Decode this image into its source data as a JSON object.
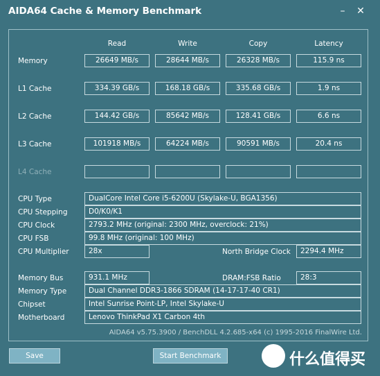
{
  "window": {
    "title": "AIDA64 Cache & Memory Benchmark",
    "minimize": "–",
    "close": "✕"
  },
  "columns": [
    "Read",
    "Write",
    "Copy",
    "Latency"
  ],
  "rows": [
    {
      "label": "Memory",
      "read": "26649 MB/s",
      "write": "28644 MB/s",
      "copy": "26328 MB/s",
      "latency": "115.9 ns"
    },
    {
      "label": "L1 Cache",
      "read": "334.39 GB/s",
      "write": "168.18 GB/s",
      "copy": "335.68 GB/s",
      "latency": "1.9 ns"
    },
    {
      "label": "L2 Cache",
      "read": "144.42 GB/s",
      "write": "85642 MB/s",
      "copy": "128.41 GB/s",
      "latency": "6.6 ns"
    },
    {
      "label": "L3 Cache",
      "read": "101918 MB/s",
      "write": "64224 MB/s",
      "copy": "90591 MB/s",
      "latency": "20.4 ns"
    },
    {
      "label": "L4 Cache",
      "read": "",
      "write": "",
      "copy": "",
      "latency": ""
    }
  ],
  "info": {
    "cpu_type": {
      "label": "CPU Type",
      "value": "DualCore Intel Core i5-6200U  (Skylake-U, BGA1356)"
    },
    "cpu_stepping": {
      "label": "CPU Stepping",
      "value": "D0/K0/K1"
    },
    "cpu_clock": {
      "label": "CPU Clock",
      "value": "2793.2 MHz  (original: 2300 MHz, overclock: 21%)"
    },
    "cpu_fsb": {
      "label": "CPU FSB",
      "value": "99.8 MHz  (original: 100 MHz)"
    },
    "cpu_multiplier": {
      "label": "CPU Multiplier",
      "value": "28x"
    },
    "north_bridge_clock": {
      "label": "North Bridge Clock",
      "value": "2294.4 MHz"
    },
    "memory_bus": {
      "label": "Memory Bus",
      "value": "931.1 MHz"
    },
    "dram_fsb_ratio": {
      "label": "DRAM:FSB Ratio",
      "value": "28:3"
    },
    "memory_type": {
      "label": "Memory Type",
      "value": "Dual Channel DDR3-1866 SDRAM  (14-17-17-40 CR1)"
    },
    "chipset": {
      "label": "Chipset",
      "value": "Intel Sunrise Point-LP, Intel Skylake-U"
    },
    "motherboard": {
      "label": "Motherboard",
      "value": "Lenovo ThinkPad X1 Carbon 4th"
    }
  },
  "footer": "AIDA64 v5.75.3900 / BenchDLL 4.2.685-x64  (c) 1995-2016 FinalWire Ltd.",
  "buttons": {
    "save": "Save",
    "start": "Start Benchmark"
  },
  "watermark": {
    "text": "什么值得买"
  }
}
